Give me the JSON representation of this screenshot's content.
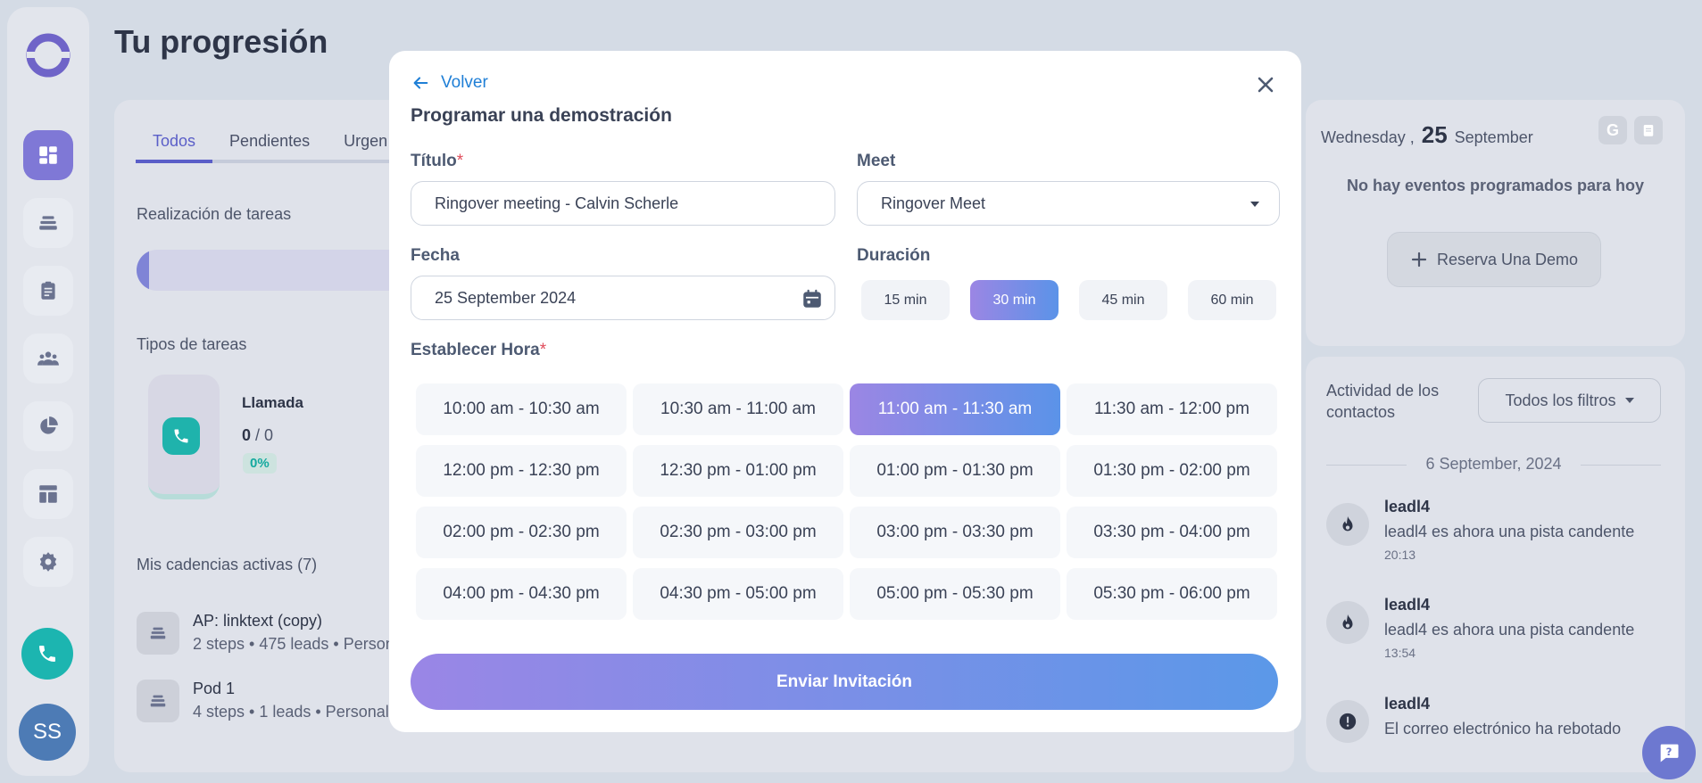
{
  "app": {
    "page_title": "Tu progresión",
    "avatar_initials": "SS"
  },
  "colors": {
    "accent_gradient_start": "#9b86e4",
    "accent_gradient_end": "#5b93e8",
    "link": "#1f7fd6",
    "required": "#e04b5a",
    "teal": "#1cb5b0"
  },
  "sidebar": {
    "items": [
      {
        "icon": "dashboard-icon",
        "active": true
      },
      {
        "icon": "cadences-icon",
        "active": false
      },
      {
        "icon": "clipboard-icon",
        "active": false
      },
      {
        "icon": "contacts-icon",
        "active": false
      },
      {
        "icon": "pie-chart-icon",
        "active": false
      },
      {
        "icon": "layout-icon",
        "active": false
      },
      {
        "icon": "settings-icon",
        "active": false
      }
    ]
  },
  "main": {
    "tabs": [
      {
        "label": "Todos",
        "active": true
      },
      {
        "label": "Pendientes",
        "active": false
      },
      {
        "label": "Urgen",
        "active": false
      }
    ],
    "task_completion_label": "Realización de tareas",
    "task_types_label": "Tipos de tareas",
    "task_type": {
      "name": "Llamada",
      "done": "0",
      "total": " / 0",
      "percent": "0%"
    },
    "cadences_label": "Mis cadencias activas (7)",
    "cadences": [
      {
        "title": "AP: linktext (copy)",
        "sub": "2 steps • 475 leads • Person"
      },
      {
        "title": "Pod 1",
        "sub": "4 steps • 1 leads • Personal"
      }
    ]
  },
  "calendar": {
    "weekday": "Wednesday ,",
    "day": "25",
    "month": "September",
    "google_letter": "G",
    "no_events": "No hay eventos programados para hoy",
    "reserve_label": "Reserva Una Demo"
  },
  "activity": {
    "title": "Actividad de los contactos",
    "filter_label": "Todos los filtros",
    "date": "6 September, 2024",
    "items": [
      {
        "icon": "fire-icon",
        "name": "leadl4",
        "text": "leadl4 es ahora una pista candente",
        "time": "20:13"
      },
      {
        "icon": "fire-icon",
        "name": "leadl4",
        "text": "leadl4 es ahora una pista candente",
        "time": "13:54"
      },
      {
        "icon": "alert-icon",
        "name": "leadl4",
        "text": "El correo electrónico ha rebotado",
        "time": ""
      }
    ]
  },
  "modal": {
    "back_label": "Volver",
    "title": "Programar una demostración",
    "title_field": {
      "label": "Título",
      "required": "*",
      "value": "Ringover meeting - Calvin Scherle"
    },
    "meet_field": {
      "label": "Meet",
      "value": "Ringover Meet"
    },
    "date_field": {
      "label": "Fecha",
      "value": "25 September 2024"
    },
    "duration": {
      "label": "Duración",
      "options": [
        "15 min",
        "30 min",
        "45 min",
        "60 min"
      ],
      "selected": "30 min"
    },
    "time": {
      "label": "Establecer Hora",
      "required": "*",
      "slots": [
        "10:00 am - 10:30 am",
        "10:30 am - 11:00 am",
        "11:00 am - 11:30 am",
        "11:30 am - 12:00 pm",
        "12:00 pm - 12:30 pm",
        "12:30 pm - 01:00 pm",
        "01:00 pm - 01:30 pm",
        "01:30 pm - 02:00 pm",
        "02:00 pm - 02:30 pm",
        "02:30 pm - 03:00 pm",
        "03:00 pm - 03:30 pm",
        "03:30 pm - 04:00 pm",
        "04:00 pm - 04:30 pm",
        "04:30 pm - 05:00 pm",
        "05:00 pm - 05:30 pm",
        "05:30 pm - 06:00 pm"
      ],
      "selected": "11:00 am - 11:30 am"
    },
    "submit_label": "Enviar Invitación"
  }
}
